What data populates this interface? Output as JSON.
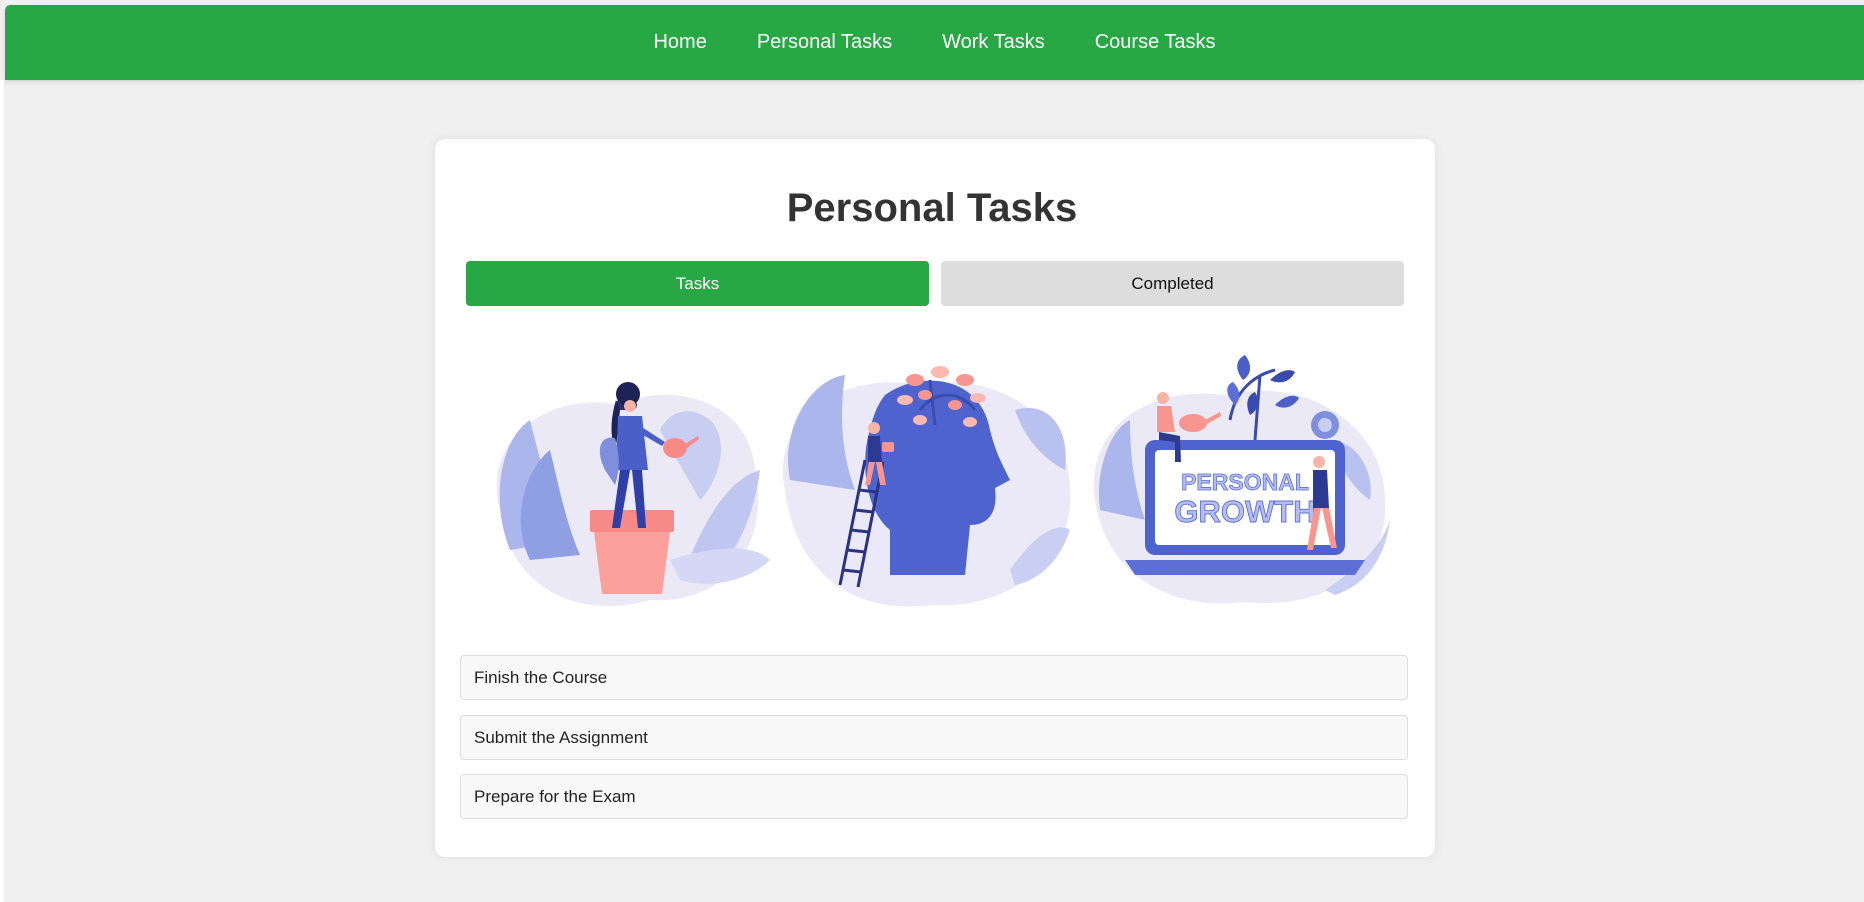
{
  "nav": {
    "items": [
      {
        "label": "Home"
      },
      {
        "label": "Personal Tasks"
      },
      {
        "label": "Work Tasks"
      },
      {
        "label": "Course Tasks"
      }
    ]
  },
  "main": {
    "title": "Personal Tasks",
    "tabs": [
      {
        "label": "Tasks",
        "active": true
      },
      {
        "label": "Completed",
        "active": false
      }
    ],
    "illustrations": [
      {
        "icon": "woman-watering-plant-icon"
      },
      {
        "icon": "head-growing-tree-icon"
      },
      {
        "icon": "personal-growth-laptop-icon",
        "text_line1": "PERSONAL",
        "text_line2": "GROWTH"
      }
    ],
    "tasks": [
      {
        "label": "Finish the Course"
      },
      {
        "label": "Submit the Assignment"
      },
      {
        "label": "Prepare for the Exam"
      }
    ]
  },
  "colors": {
    "accent": "#28a745",
    "background": "#f0f0f0",
    "tab_inactive": "#dddddd",
    "illustration_blue": "#5b6fd6",
    "illustration_pink": "#f7958e"
  }
}
